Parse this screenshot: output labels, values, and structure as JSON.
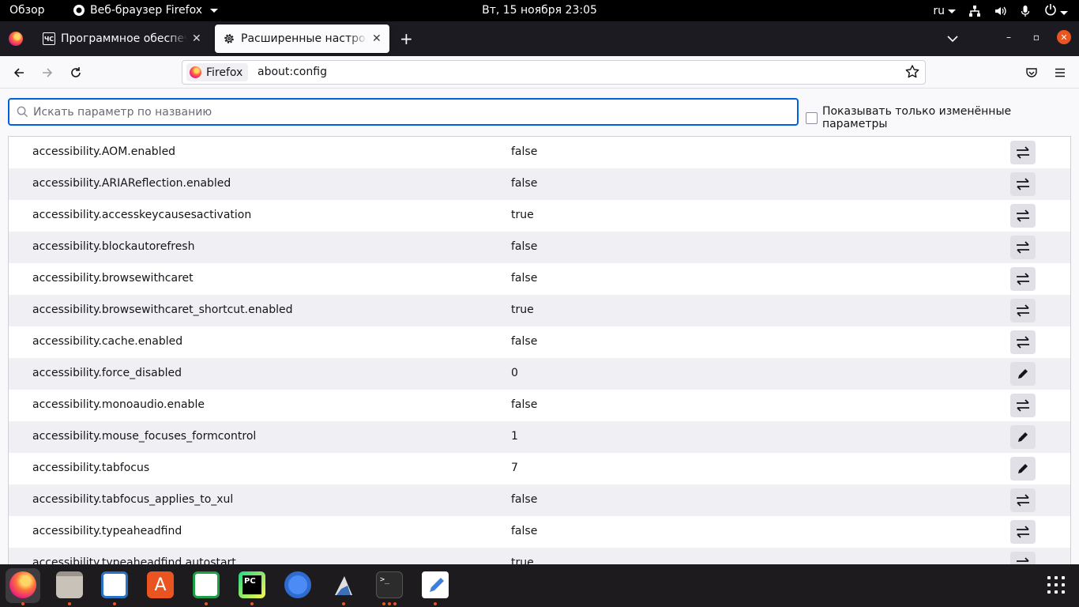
{
  "topbar": {
    "activities": "Обзор",
    "app_name": "Веб-браузер Firefox",
    "clock": "Вт, 15 ноября  23:05",
    "lang": "ru"
  },
  "tabs": [
    {
      "title": "Программное обеспечение",
      "favicon": "ЧС",
      "active": false
    },
    {
      "title": "Расширенные настройки",
      "active": true
    }
  ],
  "urlbar": {
    "identity": "Firefox",
    "url": "about:config"
  },
  "search": {
    "placeholder": "Искать параметр по названию",
    "value": ""
  },
  "modified_only_label": "Показывать только изменённые параметры",
  "prefs": [
    {
      "name": "accessibility.AOM.enabled",
      "value": "false",
      "action": "toggle"
    },
    {
      "name": "accessibility.ARIAReflection.enabled",
      "value": "false",
      "action": "toggle"
    },
    {
      "name": "accessibility.accesskeycausesactivation",
      "value": "true",
      "action": "toggle"
    },
    {
      "name": "accessibility.blockautorefresh",
      "value": "false",
      "action": "toggle"
    },
    {
      "name": "accessibility.browsewithcaret",
      "value": "false",
      "action": "toggle"
    },
    {
      "name": "accessibility.browsewithcaret_shortcut.enabled",
      "value": "true",
      "action": "toggle"
    },
    {
      "name": "accessibility.cache.enabled",
      "value": "false",
      "action": "toggle"
    },
    {
      "name": "accessibility.force_disabled",
      "value": "0",
      "action": "edit"
    },
    {
      "name": "accessibility.monoaudio.enable",
      "value": "false",
      "action": "toggle"
    },
    {
      "name": "accessibility.mouse_focuses_formcontrol",
      "value": "1",
      "action": "edit"
    },
    {
      "name": "accessibility.tabfocus",
      "value": "7",
      "action": "edit"
    },
    {
      "name": "accessibility.tabfocus_applies_to_xul",
      "value": "false",
      "action": "toggle"
    },
    {
      "name": "accessibility.typeaheadfind",
      "value": "false",
      "action": "toggle"
    },
    {
      "name": "accessibility.typeaheadfind.autostart",
      "value": "true",
      "action": "toggle"
    }
  ],
  "dock": [
    {
      "name": "firefox",
      "color": "#ff7139",
      "running": 1
    },
    {
      "name": "files",
      "color": "#b9b4ac",
      "running": 1
    },
    {
      "name": "writer",
      "color": "#2a72c4",
      "running": 1
    },
    {
      "name": "software",
      "color": "#e95420",
      "running": 0
    },
    {
      "name": "calc",
      "color": "#1e9e45",
      "running": 1
    },
    {
      "name": "pycharm",
      "color": "#21d789",
      "running": 1
    },
    {
      "name": "chromium",
      "color": "#4c8bf5",
      "running": 0
    },
    {
      "name": "inkscape",
      "color": "#5c5c5c",
      "running": 1
    },
    {
      "name": "terminal",
      "color": "#2c2c2c",
      "running": 3
    },
    {
      "name": "text-editor",
      "color": "#3d7fdc",
      "running": 1
    }
  ],
  "colors": {
    "accent": "#0061e0",
    "ubuntu_orange": "#e95420"
  }
}
